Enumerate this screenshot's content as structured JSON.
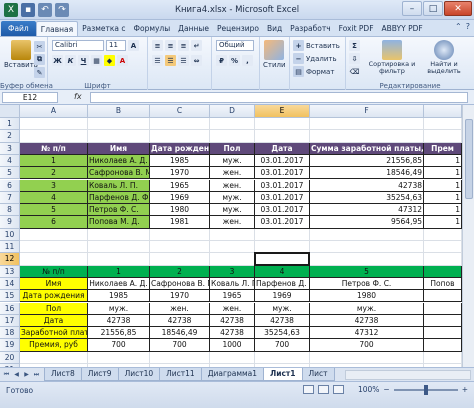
{
  "window": {
    "title": "Книга4.xlsx - Microsoft Excel",
    "minimize": "–",
    "maximize": "□",
    "close": "✕"
  },
  "ribbon_tabs": [
    "Файл",
    "Главная",
    "Разметка с",
    "Формулы",
    "Данные",
    "Рецензиро",
    "Вид",
    "Разработч",
    "Foxit PDF",
    "ABBYY PDF"
  ],
  "ribbon": {
    "paste": "Вставить",
    "font_name": "Calibri",
    "font_size": "11",
    "number_format": "Общий",
    "styles": "Стили",
    "insert": "Вставить",
    "delete": "Удалить",
    "format": "Формат",
    "sort": "Сортировка и фильтр",
    "find": "Найти и выделить",
    "groups": {
      "clipboard": "Буфер обмена",
      "font": "Шрифт",
      "editing": "Редактирование"
    }
  },
  "formula_bar": {
    "name_box": "E12",
    "fx": "fx",
    "value": ""
  },
  "columns": [
    "A",
    "B",
    "C",
    "D",
    "E",
    "F"
  ],
  "rows": [
    "1",
    "2",
    "3",
    "4",
    "5",
    "6",
    "7",
    "8",
    "9",
    "10",
    "11",
    "12",
    "13",
    "14",
    "15",
    "16",
    "17",
    "18",
    "19",
    "20",
    "21",
    "22"
  ],
  "table1": {
    "headers": [
      "№ п/п",
      "Имя",
      "Дата рождения",
      "Пол",
      "Дата",
      "Сумма заработной платы, руб.",
      "Прем"
    ],
    "rows": [
      [
        "1",
        "Николаев А. Д.",
        "1985",
        "муж.",
        "03.01.2017",
        "21556,85",
        "1"
      ],
      [
        "2",
        "Сафронова В. М.",
        "1970",
        "жен.",
        "03.01.2017",
        "18546,49",
        "1"
      ],
      [
        "3",
        "Коваль Л. П.",
        "1965",
        "жен.",
        "03.01.2017",
        "42738",
        "1"
      ],
      [
        "4",
        "Парфенов Д. Ф.",
        "1969",
        "муж.",
        "03.01.2017",
        "35254,63",
        "1"
      ],
      [
        "5",
        "Петров Ф. С.",
        "1980",
        "муж.",
        "03.01.2017",
        "47312",
        "1"
      ],
      [
        "6",
        "Попова М. Д.",
        "1981",
        "жен.",
        "03.01.2017",
        "9564,95",
        "1"
      ]
    ]
  },
  "table2": {
    "header_row": [
      "№ п/п",
      "1",
      "2",
      "3",
      "4",
      "5",
      ""
    ],
    "rows": [
      [
        "Имя",
        "Николаев А. Д.",
        "Сафронова В. М.",
        "Коваль Л. П.",
        "Парфенов Д. Ф.",
        "Петров Ф. С.",
        "Попов"
      ],
      [
        "Дата рождения",
        "1985",
        "1970",
        "1965",
        "1969",
        "1980",
        ""
      ],
      [
        "Пол",
        "муж.",
        "жен.",
        "жен.",
        "муж.",
        "муж.",
        ""
      ],
      [
        "Дата",
        "42738",
        "42738",
        "42738",
        "42738",
        "42738",
        ""
      ],
      [
        "Заработной плат",
        "21556,85",
        "18546,49",
        "42738",
        "35254,63",
        "47312",
        ""
      ],
      [
        "Премия, руб",
        "700",
        "700",
        "1000",
        "700",
        "700",
        ""
      ]
    ]
  },
  "sheets": [
    "Лист8",
    "Лист9",
    "Лист10",
    "Лист11",
    "Диаграмма1",
    "Лист1",
    "Лист"
  ],
  "active_sheet": "Лист1",
  "status": {
    "ready": "Готово",
    "zoom": "100%"
  },
  "colors": {
    "purple_header": "#5f497a",
    "green_fill": "#92d050",
    "green_band": "#00b050",
    "yellow_fill": "#ffff00"
  }
}
